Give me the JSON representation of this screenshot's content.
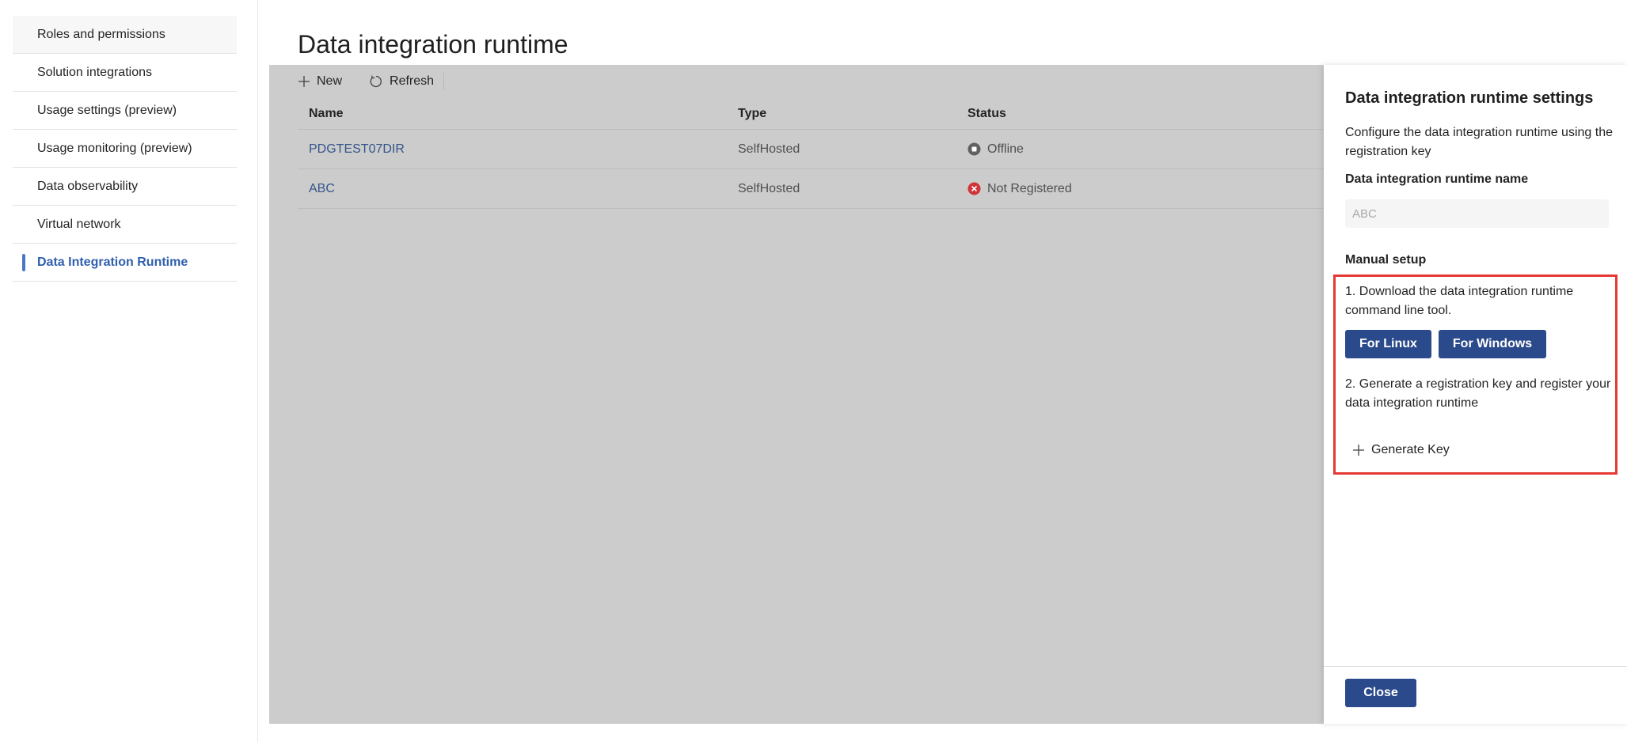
{
  "sidebar": {
    "items": [
      {
        "label": "Roles and permissions"
      },
      {
        "label": "Solution integrations"
      },
      {
        "label": "Usage settings (preview)"
      },
      {
        "label": "Usage monitoring (preview)"
      },
      {
        "label": "Data observability"
      },
      {
        "label": "Virtual network"
      },
      {
        "label": "Data Integration Runtime"
      }
    ]
  },
  "page": {
    "title": "Data integration runtime"
  },
  "toolbar": {
    "new_label": "New",
    "refresh_label": "Refresh"
  },
  "table": {
    "headers": {
      "name": "Name",
      "type": "Type",
      "status": "Status"
    },
    "rows": [
      {
        "name": "PDGTEST07DIR",
        "type": "SelfHosted",
        "status": "Offline"
      },
      {
        "name": "ABC",
        "type": "SelfHosted",
        "status": "Not Registered"
      }
    ]
  },
  "panel": {
    "title": "Data integration runtime settings",
    "description": "Configure the data integration runtime using the registration key",
    "name_label": "Data integration runtime name",
    "name_value": "ABC",
    "manual_setup_label": "Manual setup",
    "step1": "1. Download the data integration runtime command line tool.",
    "linux_button": "For Linux",
    "windows_button": "For Windows",
    "step2": "2. Generate a registration key and register your data integration runtime",
    "generate_key": "Generate Key",
    "close_button": "Close"
  },
  "colors": {
    "accent": "#2b4a8b",
    "link": "#34558b",
    "active_nav": "#2f5fae",
    "highlight_border": "#e53935",
    "overlay": "#cccccc",
    "error_status": "#d13438",
    "offline_status": "#616161"
  },
  "icons": {
    "new": "plus-icon",
    "refresh": "refresh-icon",
    "offline": "stop-circle-icon",
    "not_registered": "error-circle-icon",
    "generate_key": "plus-icon"
  }
}
